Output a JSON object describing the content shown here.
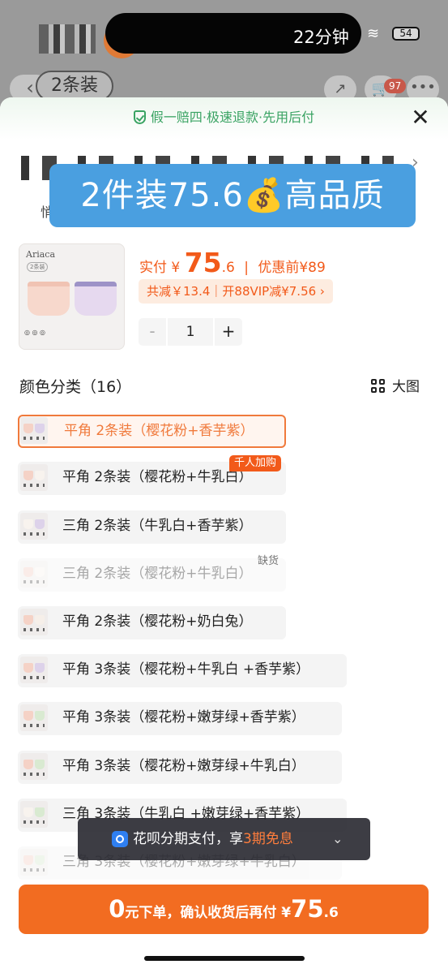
{
  "status_bar": {
    "time": "22分钟",
    "battery": "54"
  },
  "nav": {
    "title": "2条装",
    "cart_badge": "97"
  },
  "guarantee": "假一赔四·极速退款·先用后付",
  "promo_banner": "2件装75.6💰高品质",
  "title_fragment": "悄",
  "thumbnail": {
    "brand": "Ariaca",
    "tag": "2条装"
  },
  "price": {
    "paid_label": "实付",
    "currency": "¥",
    "amount_int": "75",
    "amount_dec": ".6",
    "sep": "|",
    "before_label": "优惠前",
    "before_amount": "¥89"
  },
  "discount": "共减￥13.4｜开88VIP减¥7.56 ›",
  "quantity": {
    "minus": "-",
    "value": "1",
    "plus": "+"
  },
  "section": {
    "title": "颜色分类（16）",
    "bigview": "大图"
  },
  "options": [
    {
      "label": "平角 2条装（樱花粉+香芋紫）"
    },
    {
      "label": "平角 2条装（樱花粉+牛乳白）"
    },
    {
      "label": "三角 2条装（牛乳白+香芋紫）"
    },
    {
      "label": "三角 2条装（樱花粉+牛乳白）"
    },
    {
      "label": "平角 2条装（樱花粉+奶白兔）"
    },
    {
      "label": "平角 3条装（樱花粉+牛乳白 +香芋紫）"
    },
    {
      "label": "平角 3条装（樱花粉+嫩芽绿+香芋紫）"
    },
    {
      "label": "平角 3条装（樱花粉+嫩芽绿+牛乳白）"
    },
    {
      "label": "三角 3条装（牛乳白 +嫩芽绿+香芋紫）"
    },
    {
      "label": "三角 3条装（樱花粉+嫩芽绿+牛乳白）"
    }
  ],
  "tags": {
    "hot": "千人加购",
    "out_of_stock": "缺货"
  },
  "huabei": {
    "prefix": "花呗分期支付，享",
    "highlight": "3期免息",
    "chevron": "⌄"
  },
  "cta": {
    "zero": "0",
    "text": "元下单，确认收货后再付 ¥",
    "amount_int": "75",
    "amount_dec": ".6"
  },
  "colors": {
    "accent": "#f26c21",
    "price": "#f25a1a",
    "guarantee": "#3aa363",
    "banner": "#4a9fe0"
  }
}
